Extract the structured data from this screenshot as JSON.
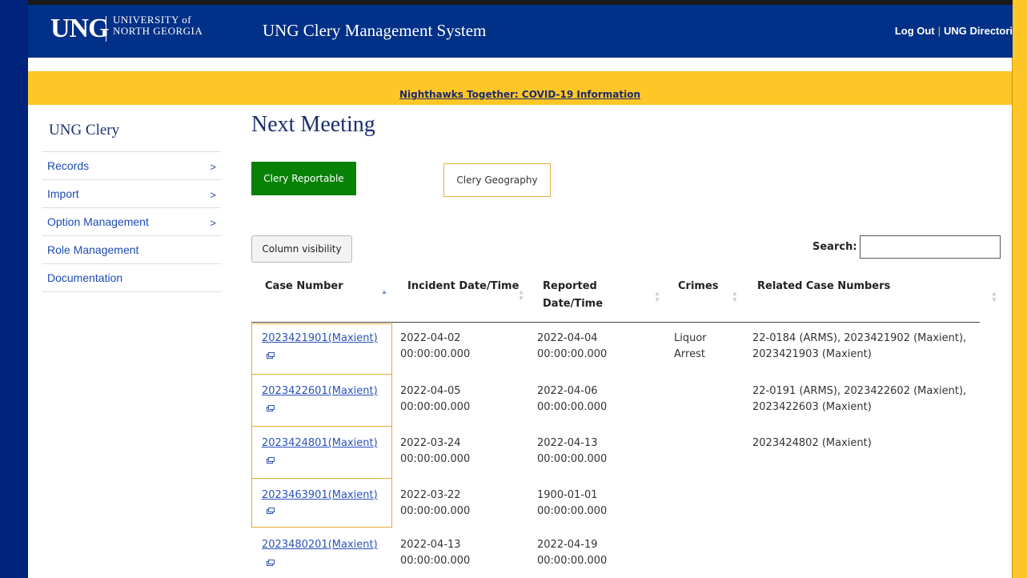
{
  "header": {
    "logo_abbr": "UNG",
    "logo_university_line1": "UNIVERSITY of",
    "logo_university_line2": "NORTH GEORGIA",
    "app_title": "UNG Clery Management System",
    "logout_label": "Log Out",
    "directory_label": "UNG Directori",
    "separator": "|"
  },
  "banner": {
    "link_text": "Nighthawks Together: COVID-19 Information"
  },
  "sidebar": {
    "title": "UNG Clery",
    "items": [
      {
        "label": "Records",
        "chevron": ">"
      },
      {
        "label": "Import",
        "chevron": ">"
      },
      {
        "label": "Option Management",
        "chevron": ">"
      },
      {
        "label": "Role Management",
        "chevron": ""
      },
      {
        "label": "Documentation",
        "chevron": ""
      }
    ]
  },
  "main": {
    "title": "Next Meeting",
    "btn_clery_reportable": "Clery Reportable",
    "btn_clery_geography": "Clery Geography",
    "btn_column_visibility": "Column visibility",
    "search_label": "Search:",
    "search_value": ""
  },
  "table": {
    "columns": [
      {
        "line1": "Case Number",
        "line2": ""
      },
      {
        "line1": "Incident Date/Time",
        "line2": ""
      },
      {
        "line1": "Reported",
        "line2": "Date/Time"
      },
      {
        "line1": "Crimes",
        "line2": ""
      },
      {
        "line1": "Related Case Numbers",
        "line2": ""
      }
    ],
    "rows": [
      {
        "case": "2023421901(Maxient)",
        "incident_date": "2022-04-02",
        "incident_time": "00:00:00.000",
        "reported_date": "2022-04-04",
        "reported_time": "00:00:00.000",
        "crime1": "Liquor",
        "crime2": "Arrest",
        "related1": "22-0184 (ARMS), 2023421902 (Maxient),",
        "related2": "2023421903 (Maxient)"
      },
      {
        "case": "2023422601(Maxient)",
        "incident_date": "2022-04-05",
        "incident_time": "00:00:00.000",
        "reported_date": "2022-04-06",
        "reported_time": "00:00:00.000",
        "crime1": "",
        "crime2": "",
        "related1": "22-0191 (ARMS), 2023422602 (Maxient),",
        "related2": "2023422603 (Maxient)"
      },
      {
        "case": "2023424801(Maxient)",
        "incident_date": "2022-03-24",
        "incident_time": "00:00:00.000",
        "reported_date": "2022-04-13",
        "reported_time": "00:00:00.000",
        "crime1": "",
        "crime2": "",
        "related1": "2023424802 (Maxient)",
        "related2": ""
      },
      {
        "case": "2023463901(Maxient)",
        "incident_date": "2022-03-22",
        "incident_time": "00:00:00.000",
        "reported_date": "1900-01-01",
        "reported_time": "00:00:00.000",
        "crime1": "",
        "crime2": "",
        "related1": "",
        "related2": ""
      },
      {
        "case": "2023480201(Maxient)",
        "incident_date": "2022-04-13",
        "incident_time": "00:00:00.000",
        "reported_date": "2022-04-19",
        "reported_time": "00:00:00.000",
        "crime1": "",
        "crime2": "",
        "related1": "",
        "related2": ""
      }
    ]
  },
  "colors": {
    "navy": "#003087",
    "gold": "#ffc627",
    "green_button": "#078207",
    "link_blue": "#2b52b8"
  }
}
